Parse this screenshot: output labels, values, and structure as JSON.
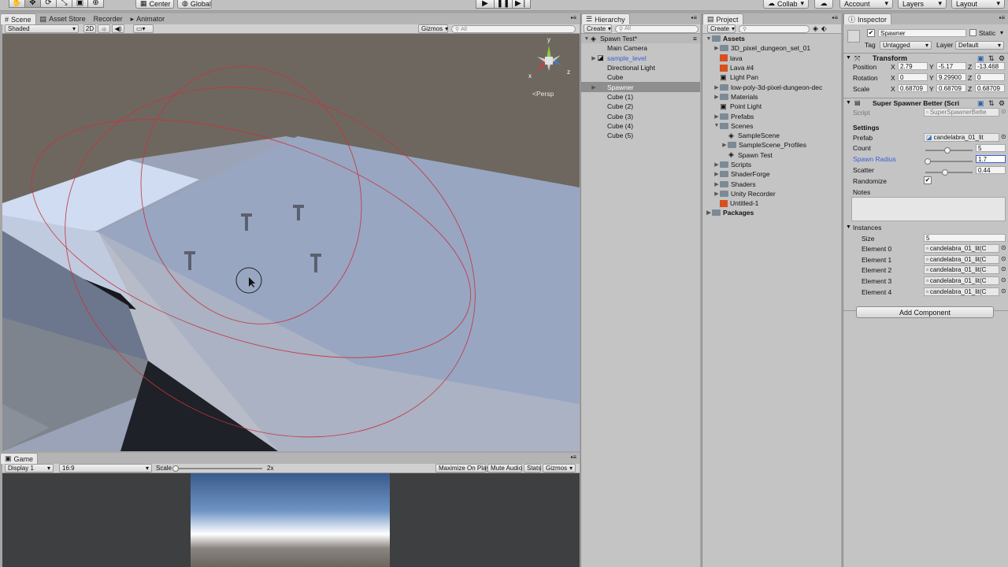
{
  "toolbar": {
    "center": "Center",
    "global": "Global",
    "collab": "Collab",
    "account": "Account",
    "layers": "Layers",
    "layout": "Layout"
  },
  "scene": {
    "tabs": [
      "Scene",
      "Asset Store",
      "Recorder",
      "Animator"
    ],
    "shading": "Shaded",
    "mode2d": "2D",
    "gizmos": "Gizmos",
    "search_placeholder": "All",
    "persp": "Persp",
    "axis": {
      "y": "y",
      "x": "x",
      "z": "z"
    }
  },
  "game": {
    "tab": "Game",
    "display": "Display 1",
    "aspect": "16:9",
    "scale_label": "Scale",
    "scale_value": "2x",
    "maximize": "Maximize On Play",
    "mute": "Mute Audio",
    "stats": "Stats",
    "gizmos": "Gizmos"
  },
  "hierarchy": {
    "tab": "Hierarchy",
    "create": "Create",
    "search_placeholder": "All",
    "scene_name": "Spawn Test*",
    "items": [
      "Main Camera",
      "sample_level",
      "Directional Light",
      "Cube",
      "Spawner",
      "Cube (1)",
      "Cube (2)",
      "Cube (3)",
      "Cube (4)",
      "Cube (5)"
    ]
  },
  "project": {
    "tab": "Project",
    "create": "Create",
    "root": "Assets",
    "items": [
      "3D_pixel_dungeon_set_01",
      "lava",
      "Lava #4",
      "Light Pan",
      "low-poly-3d-pixel-dungeon-dec",
      "Materials",
      "Point Light",
      "Prefabs",
      "Scenes",
      "SampleScene",
      "SampleScene_Profiles",
      "Spawn Test",
      "Scripts",
      "ShaderForge",
      "Shaders",
      "Unity Recorder",
      "Untitled-1"
    ],
    "packages": "Packages"
  },
  "inspector": {
    "tab": "Inspector",
    "object_name": "Spawner",
    "static_label": "Static",
    "tag_label": "Tag",
    "tag_value": "Untagged",
    "layer_label": "Layer",
    "layer_value": "Default",
    "transform": {
      "title": "Transform",
      "position_label": "Position",
      "rotation_label": "Rotation",
      "scale_label": "Scale",
      "x": "X",
      "y": "Y",
      "z": "Z",
      "position": [
        "2.79",
        "-5.17",
        "-13.468"
      ],
      "rotation": [
        "0",
        "9.29900",
        "0"
      ],
      "scale": [
        "0.68709",
        "0.68709",
        "0.68709"
      ]
    },
    "component": {
      "title": "Super Spawner Better (Scri",
      "script_label": "Script",
      "script_value": "SuperSpawnerBette",
      "settings_label": "Settings",
      "prefab_label": "Prefab",
      "prefab_value": "candelabra_01_lit",
      "count_label": "Count",
      "count_value": "5",
      "count_level": 0.5,
      "radius_label": "Spawn Radius",
      "radius_value": "1.7",
      "radius_level": 0.05,
      "scatter_label": "Scatter",
      "scatter_value": "0.44",
      "scatter_level": 0.44,
      "randomize_label": "Randomize",
      "notes_label": "Notes",
      "instances_label": "Instances",
      "size_label": "Size",
      "size_value": "5",
      "elements": [
        {
          "label": "Element 0",
          "value": "candelabra_01_lit(C"
        },
        {
          "label": "Element 1",
          "value": "candelabra_01_lit(C"
        },
        {
          "label": "Element 2",
          "value": "candelabra_01_lit(C"
        },
        {
          "label": "Element 3",
          "value": "candelabra_01_lit(C"
        },
        {
          "label": "Element 4",
          "value": "candelabra_01_lit(C"
        }
      ]
    },
    "add_component": "Add Component"
  },
  "colors": {
    "accent_blue": "#3b5fd6",
    "selection": "#8e8e8e",
    "gizmo_red": "#c8323c"
  }
}
